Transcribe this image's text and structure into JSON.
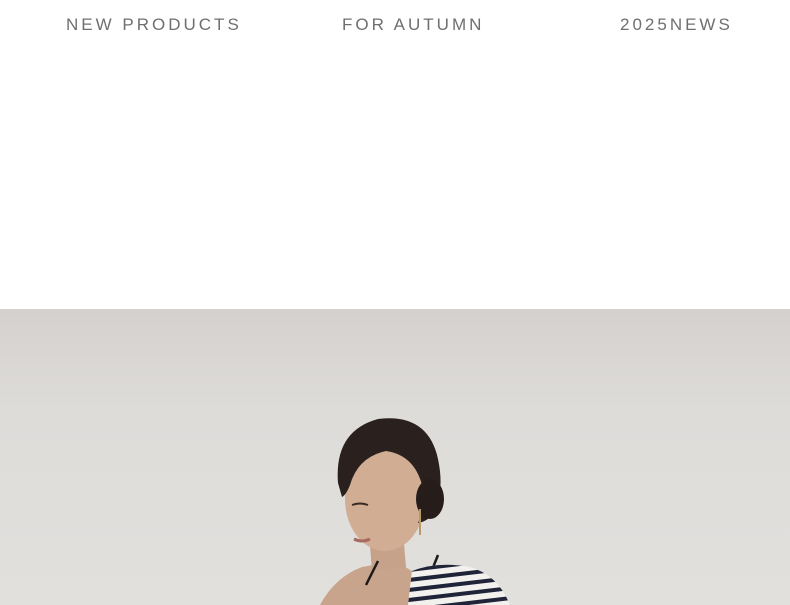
{
  "taglines": {
    "left": "NEW PRODUCTS",
    "center": "FOR AUTUMN",
    "right": "2025NEWS"
  },
  "hero": {
    "description": "",
    "background_color": "#dedcd9",
    "stripe_colors": [
      "#1f2438",
      "#f3f1ee"
    ]
  }
}
